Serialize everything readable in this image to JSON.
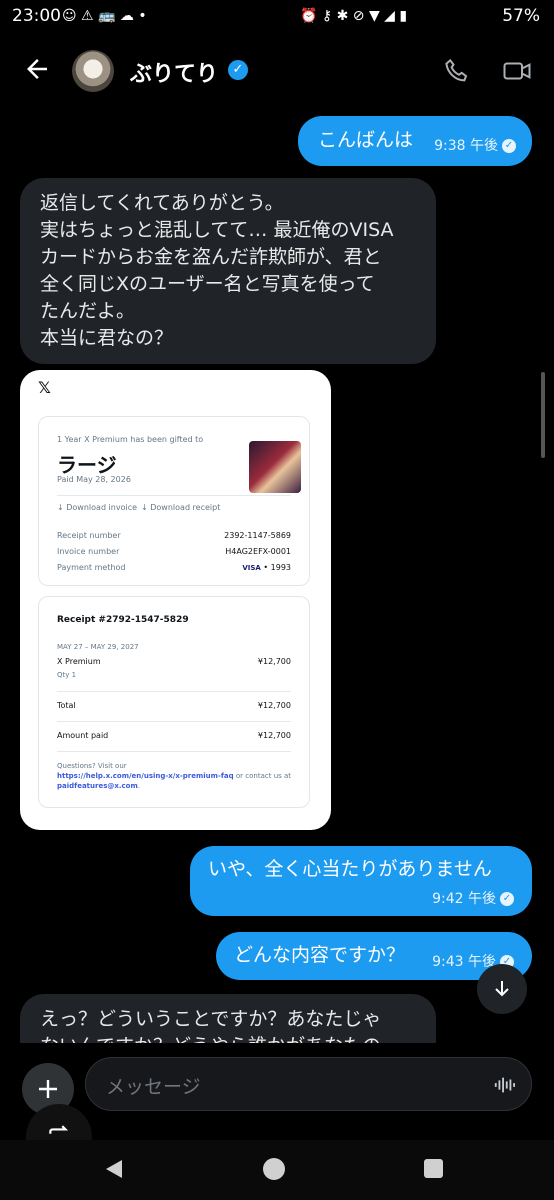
{
  "status_bar": {
    "time": "23:00",
    "battery": "57%"
  },
  "header": {
    "name": "ぶりてり"
  },
  "messages": [
    {
      "dir": "out",
      "text": "こんばんは",
      "time": "9:38 午後"
    },
    {
      "dir": "in",
      "lines": [
        "返信してくれてありがとう。",
        "実はちょっと混乱してて… 最近俺のVISA",
        "カードからお金を盗んだ詐欺師が、君と",
        "全く同じXのユーザー名と写真を使って",
        "たんだよ。",
        "本当に君なの？"
      ]
    },
    {
      "dir": "out",
      "text": "いや、全く心当たりがありません",
      "time": "9:42 午後"
    },
    {
      "dir": "out",
      "text": "どんな内容ですか？",
      "time": "9:43 午後"
    },
    {
      "dir": "in",
      "lines": [
        "えっ？どういうことですか？あなたじゃ",
        "ないんですか？どうやら誰かがあなたの"
      ]
    }
  ],
  "receipt": {
    "logo": "𝕏",
    "gift_line": "1 Year X Premium has been gifted to",
    "recipient": "ラージ",
    "paid_date": "Paid May 28, 2026",
    "download_invoice": "Download invoice",
    "download_receipt": "Download receipt",
    "receipt_number_label": "Receipt number",
    "receipt_number": "2392-1147-5869",
    "invoice_number_label": "Invoice number",
    "invoice_number": "H4AG2EFX-0001",
    "payment_method_label": "Payment method",
    "card_brand": "VISA",
    "card_last4": "• 1993",
    "receipt_title": "Receipt #2792-1547-5829",
    "period": "MAY 27 – MAY 29, 2027",
    "item": "X Premium",
    "item_price": "¥12,700",
    "qty": "Qty 1",
    "total_label": "Total",
    "total": "¥12,700",
    "amount_paid_label": "Amount paid",
    "amount_paid": "¥12,700",
    "questions": "Questions? Visit our",
    "faq_link": "https://help.x.com/en/using-x/x-premium-faq",
    "contact_text": " or contact us at",
    "email": "paidfeatures@x.com",
    "period_end": "."
  },
  "composer": {
    "placeholder": "メッセージ"
  },
  "icons": [
    "back-arrow-icon",
    "verified-icon",
    "phone-icon",
    "video-icon",
    "plus-icon",
    "voice-icon",
    "scroll-down-icon",
    "retweet-icon"
  ]
}
